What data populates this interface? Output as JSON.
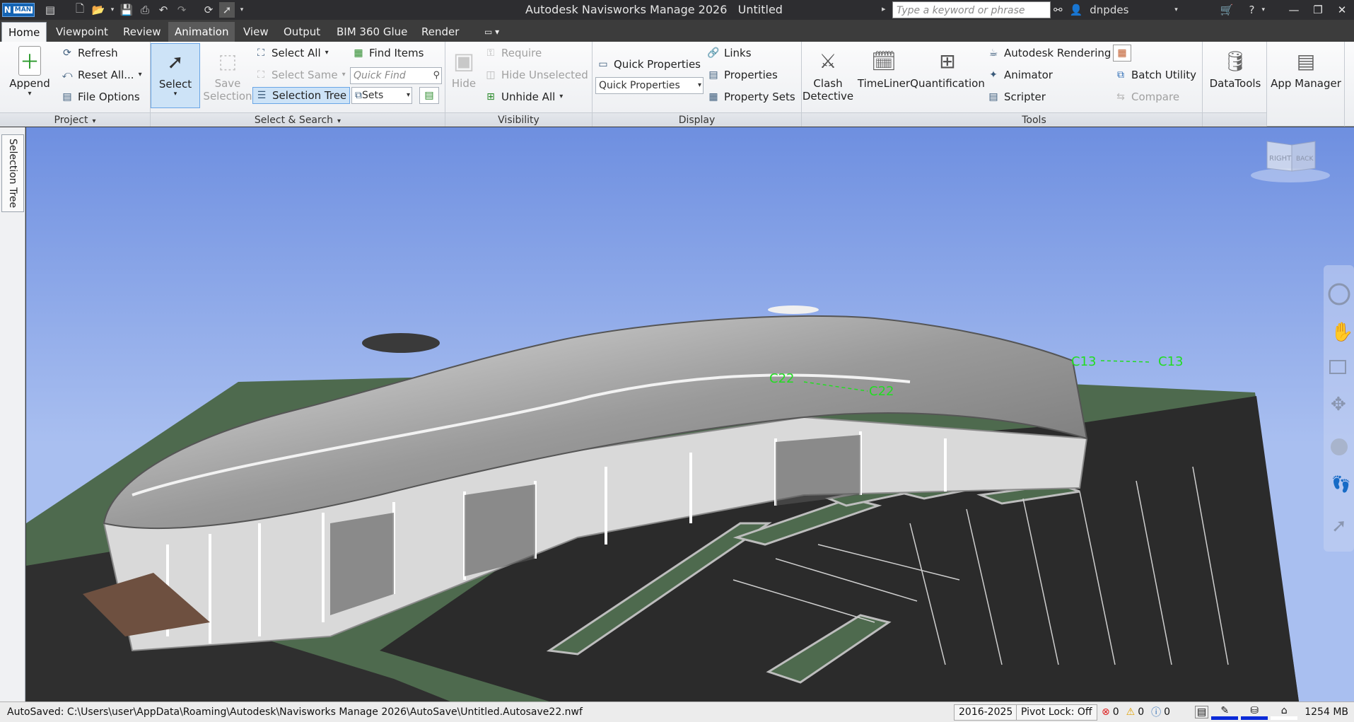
{
  "window": {
    "app_badge": "N",
    "app_badge_sub": "MAN",
    "title": "Autodesk Navisworks Manage 2026",
    "doc": "Untitled",
    "search_placeholder": "Type a keyword or phrase",
    "user": "dnpdes"
  },
  "tabs": [
    "Home",
    "Viewpoint",
    "Review",
    "Animation",
    "View",
    "Output",
    "BIM 360 Glue",
    "Render"
  ],
  "active_tab": "Home",
  "ribbon": {
    "project": {
      "title": "Project",
      "append": "Append",
      "refresh": "Refresh",
      "reset_all": "Reset All...",
      "file_options": "File Options"
    },
    "select_search": {
      "title": "Select & Search",
      "select": "Select",
      "save_selection_1": "Save",
      "save_selection_2": "Selection",
      "select_all": "Select All",
      "select_same": "Select Same",
      "selection_tree": "Selection Tree",
      "find_items": "Find Items",
      "quick_find_placeholder": "Quick Find",
      "sets": "Sets"
    },
    "visibility": {
      "title": "Visibility",
      "hide": "Hide",
      "require": "Require",
      "hide_unselected": "Hide Unselected",
      "unhide_all": "Unhide All"
    },
    "display": {
      "title": "Display",
      "quick_properties": "Quick Properties",
      "quick_properties_combo": "Quick Properties",
      "links": "Links",
      "properties": "Properties",
      "property_sets": "Property Sets"
    },
    "tools": {
      "title": "Tools",
      "clash_1": "Clash",
      "clash_2": "Detective",
      "timeliner": "TimeLiner",
      "quantification": "Quantification",
      "autodesk_rendering": "Autodesk Rendering",
      "animator": "Animator",
      "scripter": "Scripter",
      "batch_utility": "Batch Utility",
      "compare": "Compare",
      "datatools": "DataTools",
      "app_manager": "App Manager"
    }
  },
  "side_tab": "Selection Tree",
  "viewcube": {
    "face_left": "RIGHT",
    "face_right": "BACK"
  },
  "labels": [
    "C22",
    "C22",
    "C13",
    "C13"
  ],
  "status": {
    "autosaved": "AutoSaved: C:\\Users\\user\\AppData\\Roaming\\Autodesk\\Navisworks Manage 2026\\AutoSave\\Untitled.Autosave22.nwf",
    "range": "2016-2025",
    "pivot_lock": "Pivot Lock: Off",
    "errors": "0",
    "warnings": "0",
    "infos": "0",
    "memory": "1254 MB"
  },
  "colors": {
    "sky_top": "#6e8fe0",
    "sky_bottom": "#a9bff0",
    "ground": "#4e6a4e",
    "asphalt": "#2b2b2b",
    "label": "#22dd22"
  }
}
